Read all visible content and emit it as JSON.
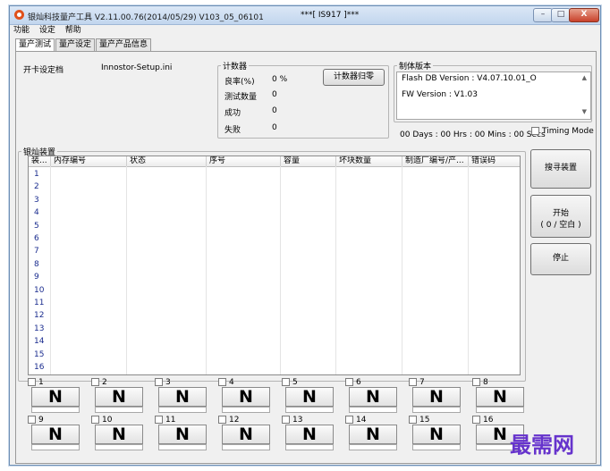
{
  "window": {
    "title": "银灿科技量产工具 V2.11.00.76(2014/05/29)   V103_05_06101",
    "title_mid": "***[ IS917 ]***",
    "min_glyph": "–",
    "max_glyph": "□",
    "close_glyph": "X"
  },
  "menu": [
    "功能",
    "设定",
    "帮助"
  ],
  "tabs": [
    "量产测试",
    "量产设定",
    "量产产品信息"
  ],
  "setup": {
    "label": "开卡设定档",
    "value": "Innostor-Setup.ini"
  },
  "counter": {
    "legend": "计数器",
    "rate_label": "良率(%)",
    "rate_value": "0 %",
    "tested_label": "测试数量",
    "tested_value": "0",
    "success_label": "成功",
    "success_value": "0",
    "fail_label": "失败",
    "fail_value": "0",
    "reset_button": "计数器归零"
  },
  "firmware": {
    "legend": "制体版本",
    "flash_db": "Flash DB Version :  V4.07.10.01_O",
    "fw": "FW Version :   V1.03"
  },
  "timer": "00 Days : 00 Hrs : 00 Mins : 00 Secs",
  "timing_mode": "Timing Mode",
  "devices": {
    "legend": "银灿装置",
    "columns": [
      "装...",
      "内存编号",
      "状态",
      "序号",
      "容量",
      "坏块数量",
      "制造厂编号/产...",
      "错误码"
    ],
    "rows": [
      "1",
      "2",
      "3",
      "4",
      "5",
      "6",
      "7",
      "8",
      "9",
      "10",
      "11",
      "12",
      "13",
      "14",
      "15",
      "16"
    ]
  },
  "side_buttons": {
    "scan": "搜寻装置",
    "start_line1": "开始",
    "start_line2": "( 0 / 空白 )",
    "stop": "停止"
  },
  "ports": [
    {
      "num": "1",
      "state": "N"
    },
    {
      "num": "2",
      "state": "N"
    },
    {
      "num": "3",
      "state": "N"
    },
    {
      "num": "4",
      "state": "N"
    },
    {
      "num": "5",
      "state": "N"
    },
    {
      "num": "6",
      "state": "N"
    },
    {
      "num": "7",
      "state": "N"
    },
    {
      "num": "8",
      "state": "N"
    },
    {
      "num": "9",
      "state": "N"
    },
    {
      "num": "10",
      "state": "N"
    },
    {
      "num": "11",
      "state": "N"
    },
    {
      "num": "12",
      "state": "N"
    },
    {
      "num": "13",
      "state": "N"
    },
    {
      "num": "14",
      "state": "N"
    },
    {
      "num": "15",
      "state": "N"
    },
    {
      "num": "16",
      "state": "N"
    }
  ],
  "watermark": "最需网"
}
